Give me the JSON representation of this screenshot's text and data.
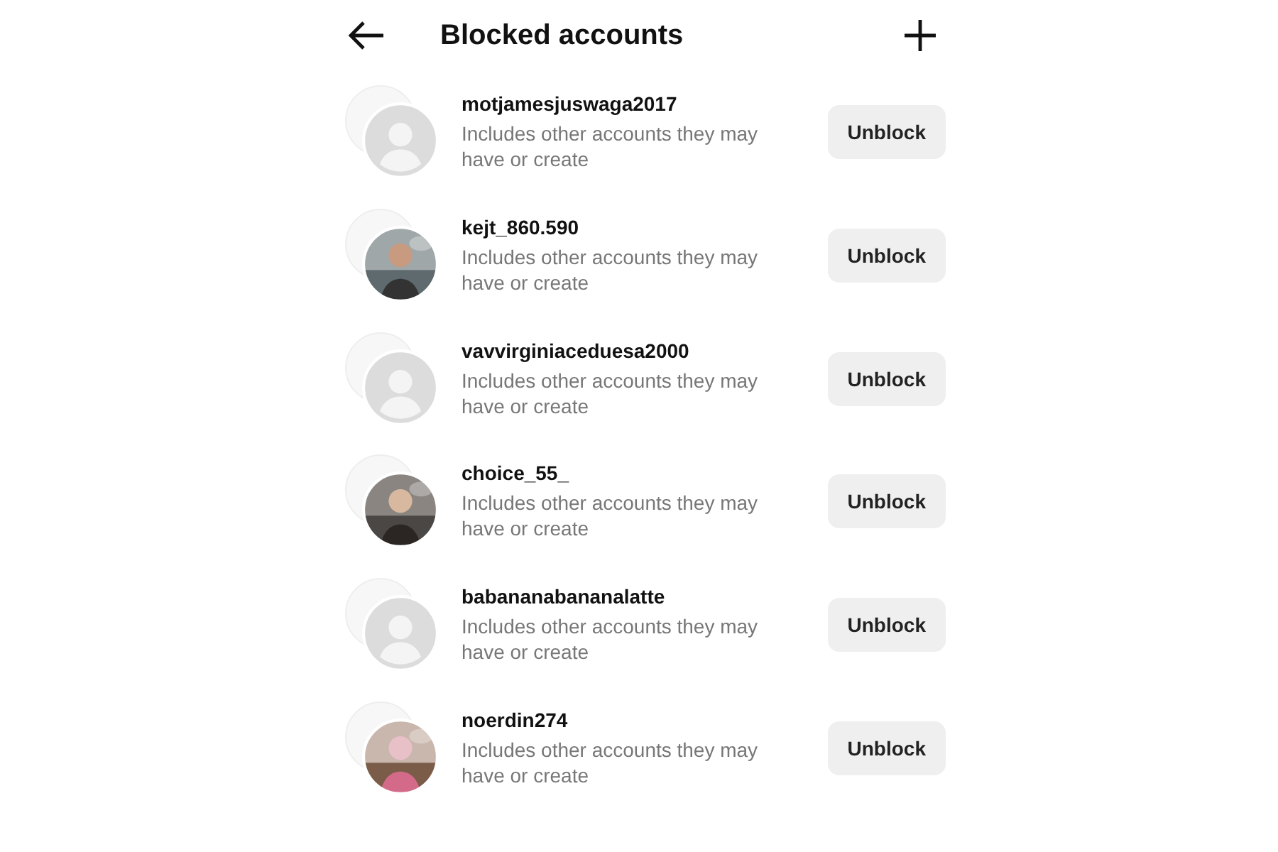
{
  "header": {
    "title": "Blocked accounts"
  },
  "accounts": [
    {
      "username": "motjamesjuswaga2017",
      "note": "Includes other accounts they may have or create",
      "avatar": {
        "kind": "default"
      },
      "button": "Unblock"
    },
    {
      "username": "kejt_860.590",
      "note": "Includes other accounts they may have or create",
      "button": "Unblock"
    },
    {
      "username": "vavvirginiaceduesa2000",
      "note": "Includes other accounts they may have or create",
      "avatar": {
        "kind": "default"
      },
      "button": "Unblock"
    },
    {
      "username": "choice_55_",
      "note": "Includes other accounts they may have or create",
      "button": "Unblock"
    },
    {
      "username": "babananabananalatte",
      "note": "Includes other accounts they may have or create",
      "avatar": {
        "kind": "default"
      },
      "button": "Unblock"
    },
    {
      "username": "noerdin274",
      "note": "Includes other accounts they may have or create",
      "button": "Unblock"
    }
  ]
}
